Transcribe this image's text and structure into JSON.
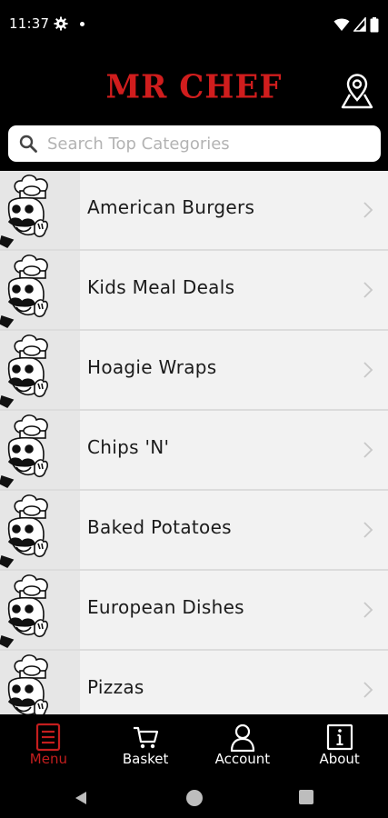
{
  "status_bar": {
    "time": "11:37",
    "icons": [
      "gear-icon",
      "notification-dot-icon",
      "wifi-icon",
      "signal-icon",
      "battery-icon"
    ]
  },
  "header": {
    "brand_title": "MR CHEF",
    "brand_color": "#d01d1d",
    "location_icon": "map-pin-icon"
  },
  "search": {
    "placeholder": "Search Top Categories",
    "value": ""
  },
  "categories": [
    {
      "label": "American Burgers",
      "thumbnail": "chef-mascot-image"
    },
    {
      "label": "Kids Meal Deals",
      "thumbnail": "chef-mascot-image"
    },
    {
      "label": "Hoagie Wraps",
      "thumbnail": "chef-mascot-image"
    },
    {
      "label": "Chips 'N'",
      "thumbnail": "chef-mascot-image"
    },
    {
      "label": "Baked Potatoes",
      "thumbnail": "chef-mascot-image"
    },
    {
      "label": "European Dishes",
      "thumbnail": "chef-mascot-image"
    },
    {
      "label": "Pizzas",
      "thumbnail": "chef-mascot-image"
    }
  ],
  "tabs": [
    {
      "label": "Menu",
      "icon": "menu-list-icon",
      "active": true
    },
    {
      "label": "Basket",
      "icon": "cart-icon",
      "active": false
    },
    {
      "label": "Account",
      "icon": "user-icon",
      "active": false
    },
    {
      "label": "About",
      "icon": "info-icon",
      "active": false
    }
  ],
  "colors": {
    "active_tab": "#c41e1e",
    "background": "#000000",
    "list_row": "#f2f2f2"
  }
}
